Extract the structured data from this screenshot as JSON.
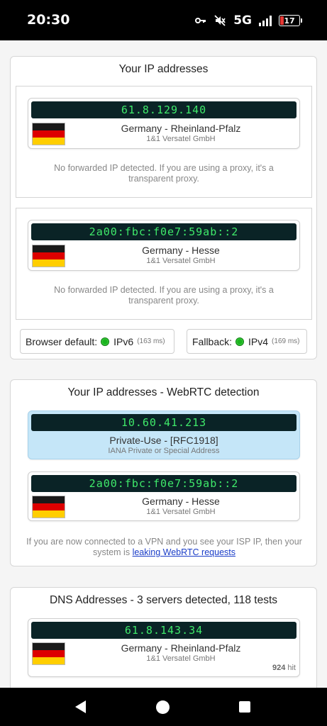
{
  "status_bar": {
    "time": "20:30",
    "network": "5G",
    "battery_level": "17",
    "icons": [
      "key-icon",
      "mute-icon",
      "signal-icon",
      "battery-icon"
    ]
  },
  "ip_section": {
    "title": "Your IP addresses",
    "entries": [
      {
        "ip": "61.8.129.140",
        "location": "Germany - Rheinland-Pfalz",
        "isp": "1&1 Versatel GmbH",
        "note": "No forwarded IP detected. If you are using a proxy, it's a transparent proxy."
      },
      {
        "ip": "2a00:fbc:f0e7:59ab::2",
        "location": "Germany - Hesse",
        "isp": "1&1 Versatel GmbH",
        "note": "No forwarded IP detected. If you are using a proxy, it's a transparent proxy."
      }
    ],
    "browser_default": {
      "label": "Browser default:",
      "protocol": "IPv6",
      "latency": "(163 ms)"
    },
    "fallback": {
      "label": "Fallback:",
      "protocol": "IPv4",
      "latency": "(169 ms)"
    }
  },
  "webrtc_section": {
    "title": "Your IP addresses - WebRTC detection",
    "entries": [
      {
        "ip": "10.60.41.213",
        "location": "Private-Use - [RFC1918]",
        "isp": "IANA Private or Special Address"
      },
      {
        "ip": "2a00:fbc:f0e7:59ab::2",
        "location": "Germany - Hesse",
        "isp": "1&1 Versatel GmbH"
      }
    ],
    "note_before": "If you are now connected to a VPN and you see your ISP IP, then your system is",
    "note_link": "leaking WebRTC requests"
  },
  "dns_section": {
    "title": "DNS Addresses - 3 servers detected, 118 tests",
    "entries": [
      {
        "ip": "61.8.143.34",
        "location": "Germany - Rheinland-Pfalz",
        "isp": "1&1 Versatel GmbH",
        "hits": "924",
        "hits_suffix": "hit"
      }
    ]
  },
  "colors": {
    "lcd_background": "#0a2326",
    "lcd_text": "#3fe96a",
    "status_dot": "#19b21d",
    "private_highlight": "#c5e6f8",
    "link": "#1a3dc8"
  }
}
